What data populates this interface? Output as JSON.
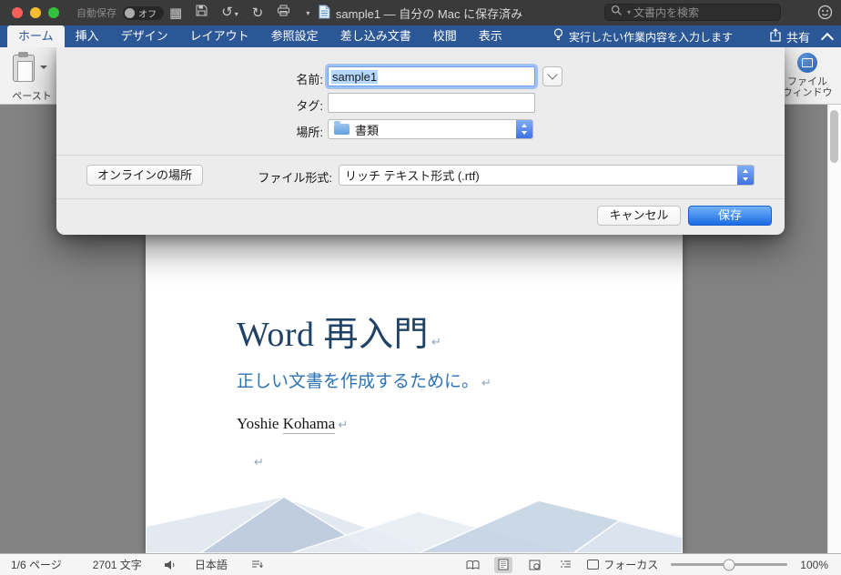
{
  "titlebar": {
    "autosave_label": "自動保存",
    "autosave_state": "オフ",
    "title": "sample1 — 自分の Mac に保存済み",
    "search_placeholder": "文書内を検索"
  },
  "tabs": {
    "items": [
      {
        "label": "ホーム",
        "active": true
      },
      {
        "label": "挿入"
      },
      {
        "label": "デザイン"
      },
      {
        "label": "レイアウト"
      },
      {
        "label": "参照設定"
      },
      {
        "label": "差し込み文書"
      },
      {
        "label": "校閲"
      },
      {
        "label": "表示"
      }
    ],
    "tellme": "実行したい作業内容を入力します",
    "share_label": "共有"
  },
  "ribbon": {
    "paste_label": "ペースト",
    "file_window_line1": "ファイル",
    "file_window_line2": "ウィンドウ"
  },
  "save_dialog": {
    "name_label": "名前:",
    "name_value": "sample1",
    "tags_label": "タグ:",
    "tags_value": "",
    "where_label": "場所:",
    "where_value": "書類",
    "online_locations_button": "オンラインの場所",
    "file_format_label": "ファイル形式:",
    "file_format_value": "リッチ テキスト形式 (.rtf)",
    "cancel_button": "キャンセル",
    "save_button": "保存"
  },
  "document": {
    "title": "Word 再入門",
    "subtitle": "正しい文書を作成するために。",
    "author_first": "Yoshie ",
    "author_last": "Kohama",
    "paragraph_mark": "↵"
  },
  "statusbar": {
    "page_indicator": "1/6 ページ",
    "char_count": "2701 文字",
    "language": "日本語",
    "focus_label": "フォーカス",
    "zoom_level": "100%"
  },
  "icons": {
    "grid": "▦",
    "undo": "↺",
    "redo": "↻",
    "chevron_down": "▾"
  },
  "colors": {
    "ribbon_blue": "#2b5797",
    "save_button_blue": "#1a6be4",
    "selection_blue": "#b3d7fe",
    "doc_title_navy": "#1f4266",
    "doc_subtitle_blue": "#2e74b5"
  }
}
